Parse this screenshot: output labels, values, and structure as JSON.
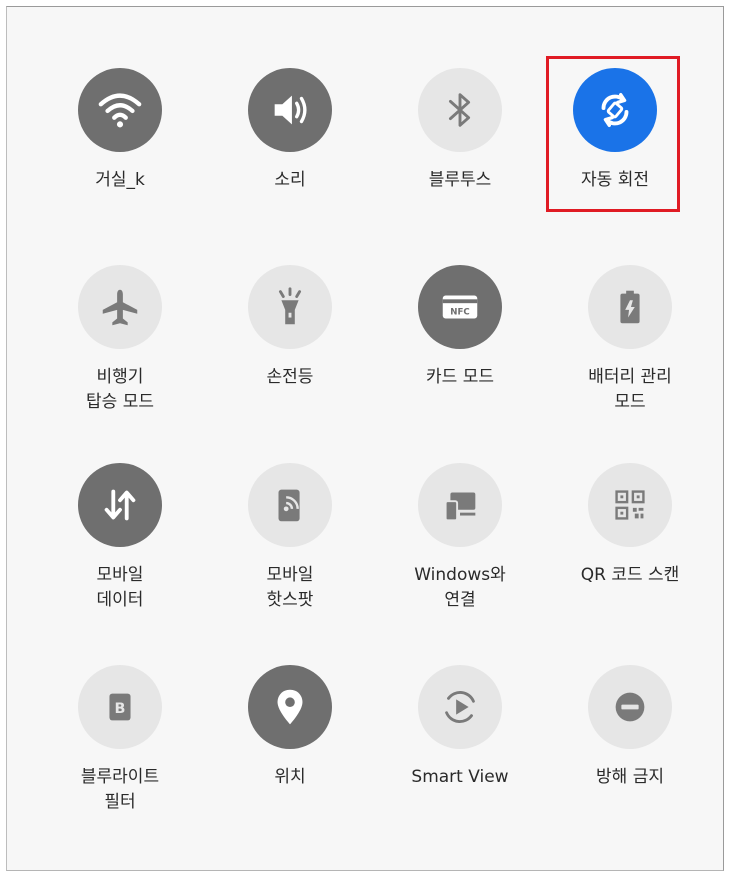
{
  "panel": {
    "accent_on": "#6f6f6f",
    "accent_active": "#1a73e8",
    "off_bg": "#e6e6e6",
    "highlight_color": "#e01b24"
  },
  "tiles": [
    {
      "label": "거실_k",
      "icon": "wifi-icon",
      "state": "on"
    },
    {
      "label": "소리",
      "icon": "volume-icon",
      "state": "on"
    },
    {
      "label": "블루투스",
      "icon": "bluetooth-icon",
      "state": "off"
    },
    {
      "label": "자동 회전",
      "icon": "auto-rotate-icon",
      "state": "active"
    },
    {
      "label": "비행기\n탑승 모드",
      "icon": "airplane-icon",
      "state": "off"
    },
    {
      "label": "손전등",
      "icon": "flashlight-icon",
      "state": "off"
    },
    {
      "label": "카드 모드",
      "icon": "nfc-card-icon",
      "state": "on"
    },
    {
      "label": "배터리 관리\n모드",
      "icon": "battery-icon",
      "state": "off"
    },
    {
      "label": "모바일\n데이터",
      "icon": "mobile-data-icon",
      "state": "on"
    },
    {
      "label": "모바일\n핫스팟",
      "icon": "hotspot-icon",
      "state": "off"
    },
    {
      "label": "Windows와\n연결",
      "icon": "link-to-windows-icon",
      "state": "off"
    },
    {
      "label": "QR 코드 스캔",
      "icon": "qr-code-icon",
      "state": "off"
    },
    {
      "label": "블루라이트\n필터",
      "icon": "blue-light-filter-icon",
      "state": "off"
    },
    {
      "label": "위치",
      "icon": "location-pin-icon",
      "state": "on"
    },
    {
      "label": "Smart View",
      "icon": "smart-view-icon",
      "state": "off"
    },
    {
      "label": "방해 금지",
      "icon": "do-not-disturb-icon",
      "state": "off"
    }
  ]
}
